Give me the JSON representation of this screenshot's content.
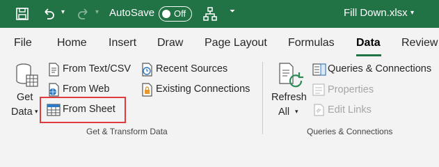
{
  "titlebar": {
    "autosave_label": "AutoSave",
    "autosave_state": "Off",
    "filename": "Fill Down.xlsx",
    "icons": [
      "save-icon",
      "undo-icon",
      "redo-icon",
      "tree-icon",
      "customize-caret-icon"
    ]
  },
  "tabs": [
    {
      "label": "File"
    },
    {
      "label": "Home"
    },
    {
      "label": "Insert"
    },
    {
      "label": "Draw"
    },
    {
      "label": "Page Layout"
    },
    {
      "label": "Formulas"
    },
    {
      "label": "Data",
      "active": true
    },
    {
      "label": "Review"
    }
  ],
  "ribbon": {
    "get_data": {
      "line1": "Get",
      "line2": "Data"
    },
    "from_text_csv": "From Text/CSV",
    "from_web": "From Web",
    "from_sheet": "From Sheet",
    "recent_sources": "Recent Sources",
    "existing_connections": "Existing Connections",
    "group1_label": "Get & Transform Data",
    "refresh": {
      "line1": "Refresh",
      "line2": "All"
    },
    "queries_connections": "Queries & Connections",
    "properties": "Properties",
    "edit_links": "Edit Links",
    "group2_label": "Queries & Connections"
  },
  "colors": {
    "accent": "#217346",
    "highlight": "#e0393e"
  }
}
